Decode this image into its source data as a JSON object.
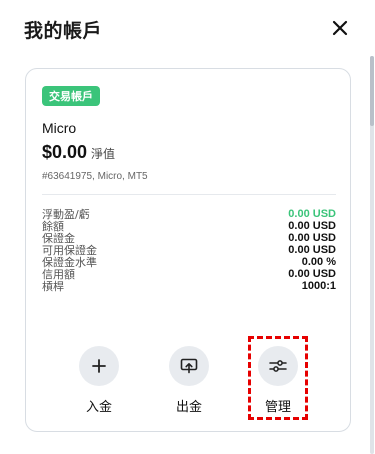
{
  "header": {
    "title": "我的帳戶",
    "close_icon": "close-icon"
  },
  "account": {
    "badge": "交易帳戶",
    "name": "Micro",
    "equity_value": "$0.00",
    "equity_label": "淨值",
    "meta": "#63641975, Micro, MT5"
  },
  "stats": [
    {
      "label": "浮動盈/虧",
      "value": "0.00 USD",
      "positive": true
    },
    {
      "label": "餘額",
      "value": "0.00 USD",
      "positive": false
    },
    {
      "label": "保證金",
      "value": "0.00 USD",
      "positive": false
    },
    {
      "label": "可用保證金",
      "value": "0.00 USD",
      "positive": false
    },
    {
      "label": "保證金水準",
      "value": "0.00 %",
      "positive": false
    },
    {
      "label": "信用額",
      "value": "0.00 USD",
      "positive": false
    },
    {
      "label": "槓桿",
      "value": "1000:1",
      "positive": false
    }
  ],
  "actions": {
    "deposit": {
      "label": "入金",
      "icon": "plus-icon"
    },
    "withdraw": {
      "label": "出金",
      "icon": "withdraw-icon"
    },
    "manage": {
      "label": "管理",
      "icon": "settings-sliders-icon"
    }
  },
  "colors": {
    "accent_green": "#3bc47a",
    "highlight_red": "#e60000"
  }
}
